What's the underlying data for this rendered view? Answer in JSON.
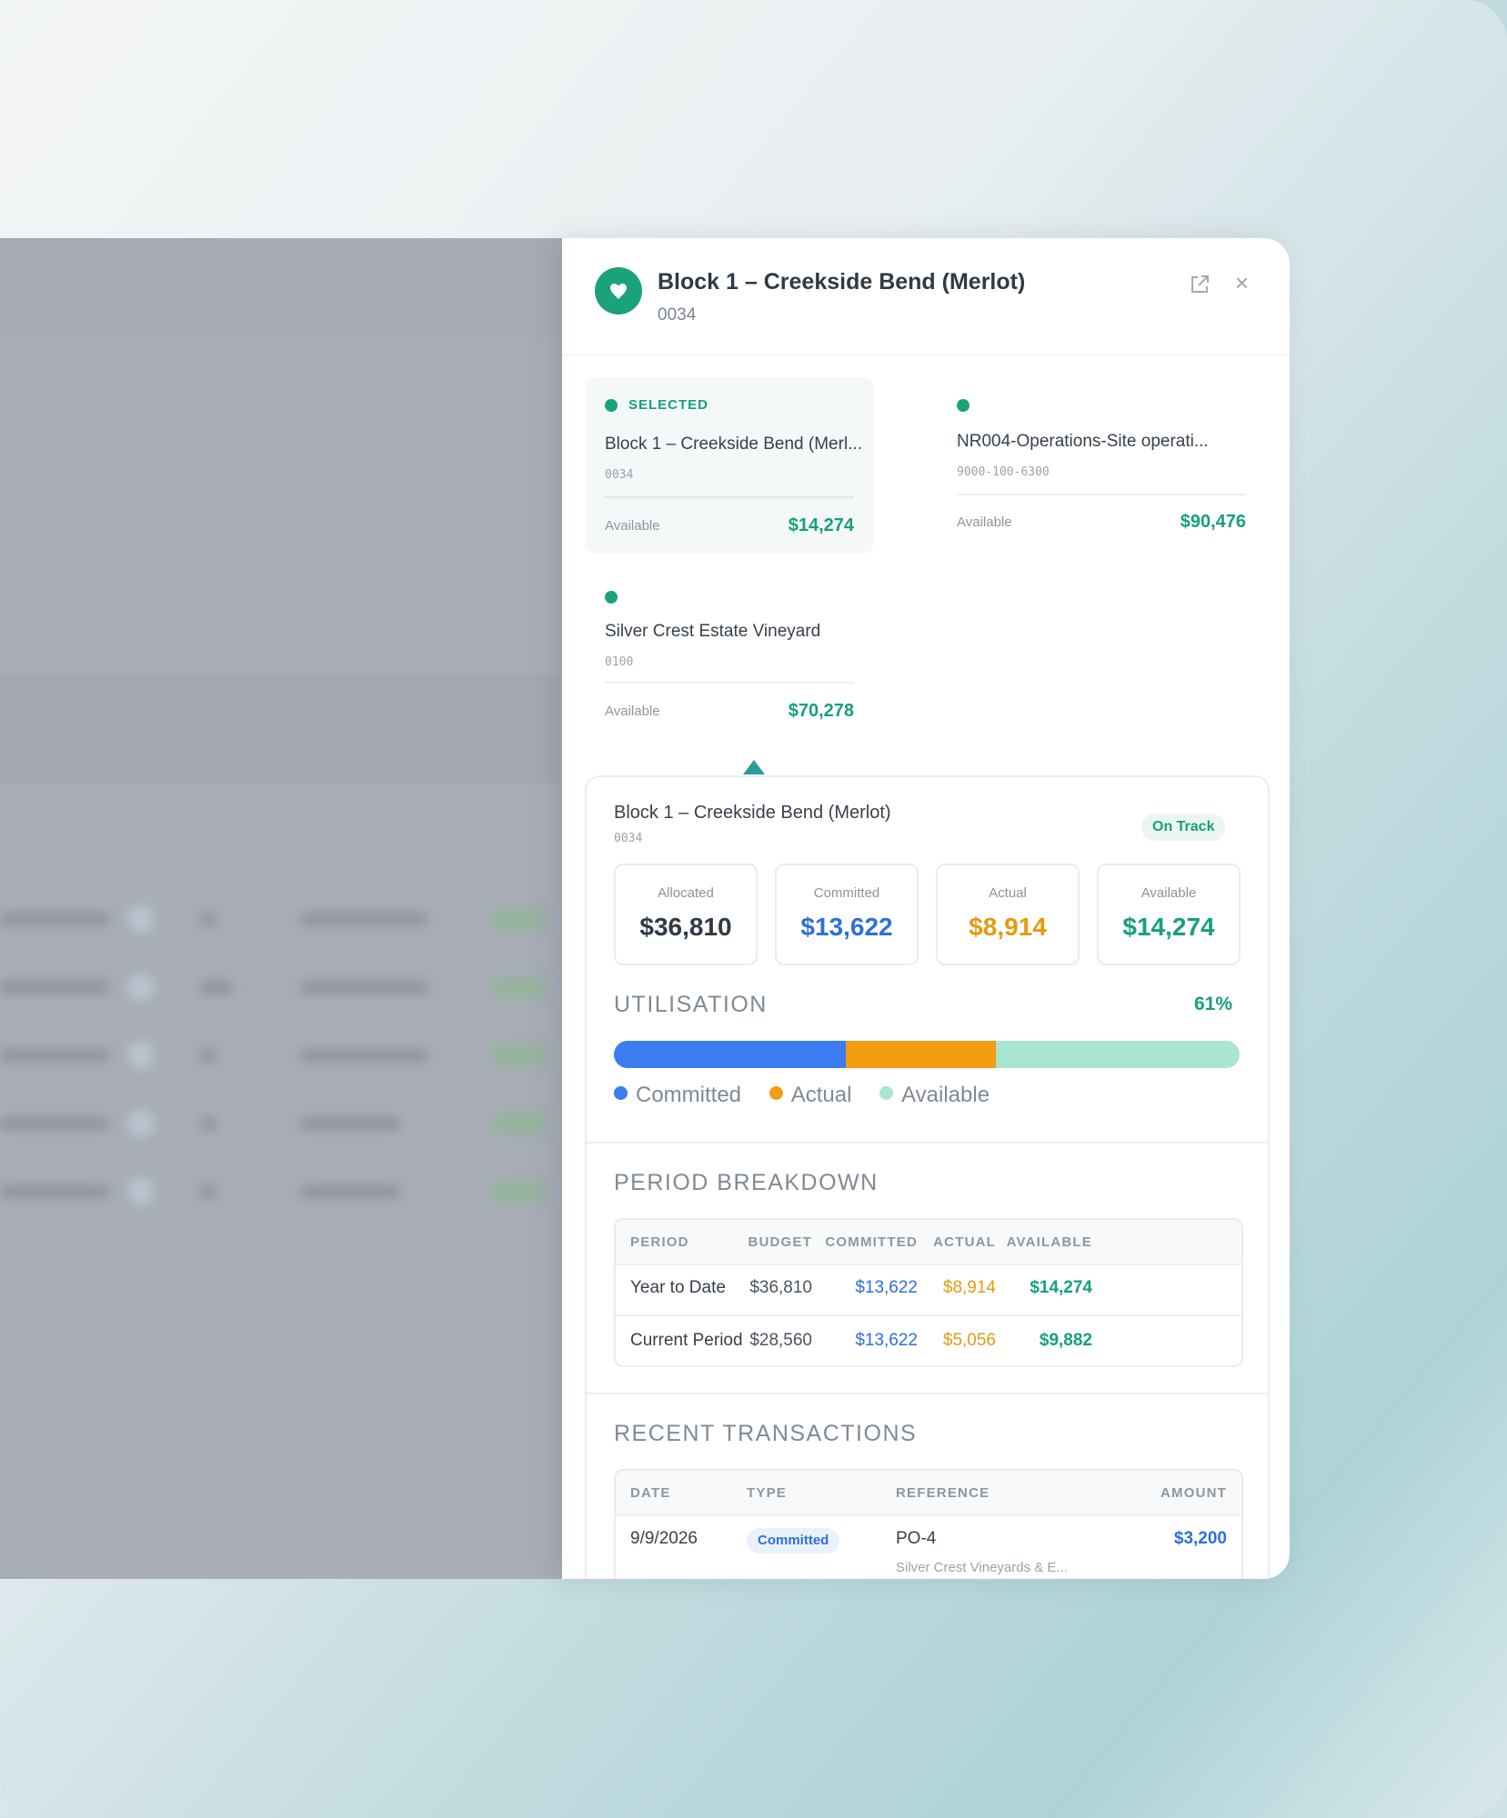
{
  "panel": {
    "title": "Block 1 – Creekside Bend (Merlot)",
    "code": "0034",
    "open_icon": "external-link-icon",
    "close_icon": "close-icon",
    "close_glyph": "×"
  },
  "accounts": [
    {
      "tag": "SELECTED",
      "title": "Block 1 – Creekside Bend (Merl...",
      "code": "0034",
      "available_label": "Available",
      "available": "$14,274"
    },
    {
      "tag": "",
      "title": "NR004-Operations-Site operati...",
      "code": "9000-100-6300",
      "available_label": "Available",
      "available": "$90,476"
    },
    {
      "tag": "",
      "title": "Silver Crest Estate Vineyard",
      "code": "0100",
      "available_label": "Available",
      "available": "$70,278"
    }
  ],
  "detail": {
    "title": "Block 1 – Creekside Bend (Merlot)",
    "code": "0034",
    "status": "On Track",
    "metrics": [
      {
        "label": "Allocated",
        "value": "$36,810"
      },
      {
        "label": "Committed",
        "value": "$13,622"
      },
      {
        "label": "Actual",
        "value": "$8,914"
      },
      {
        "label": "Available",
        "value": "$14,274"
      }
    ],
    "utilisation": {
      "heading": "UTILISATION",
      "percent": "61%",
      "segments": [
        {
          "label": "Committed",
          "fraction": 0.37,
          "color": "#3b7df0"
        },
        {
          "label": "Actual",
          "fraction": 0.24,
          "color": "#f29d12"
        },
        {
          "label": "Available",
          "fraction": 0.39,
          "color": "#a8e6cf"
        }
      ]
    },
    "period_breakdown": {
      "heading": "PERIOD BREAKDOWN",
      "columns": [
        "PERIOD",
        "BUDGET",
        "COMMITTED",
        "ACTUAL",
        "AVAILABLE"
      ],
      "rows": [
        {
          "period": "Year to Date",
          "budget": "$36,810",
          "committed": "$13,622",
          "actual": "$8,914",
          "available": "$14,274"
        },
        {
          "period": "Current Period",
          "budget": "$28,560",
          "committed": "$13,622",
          "actual": "$5,056",
          "available": "$9,882"
        }
      ]
    },
    "recent_transactions": {
      "heading": "RECENT TRANSACTIONS",
      "columns": [
        "DATE",
        "TYPE",
        "REFERENCE",
        "AMOUNT"
      ],
      "rows": [
        {
          "date": "9/9/2026",
          "type": "Committed",
          "reference": "PO-4",
          "vendor": "Silver Crest Vineyards & E...",
          "amount": "$3,200"
        }
      ]
    }
  },
  "colors": {
    "accent": "#1aa37b",
    "committed": "#2e6fd8",
    "actual": "#e49a12",
    "available": "#17a078"
  }
}
